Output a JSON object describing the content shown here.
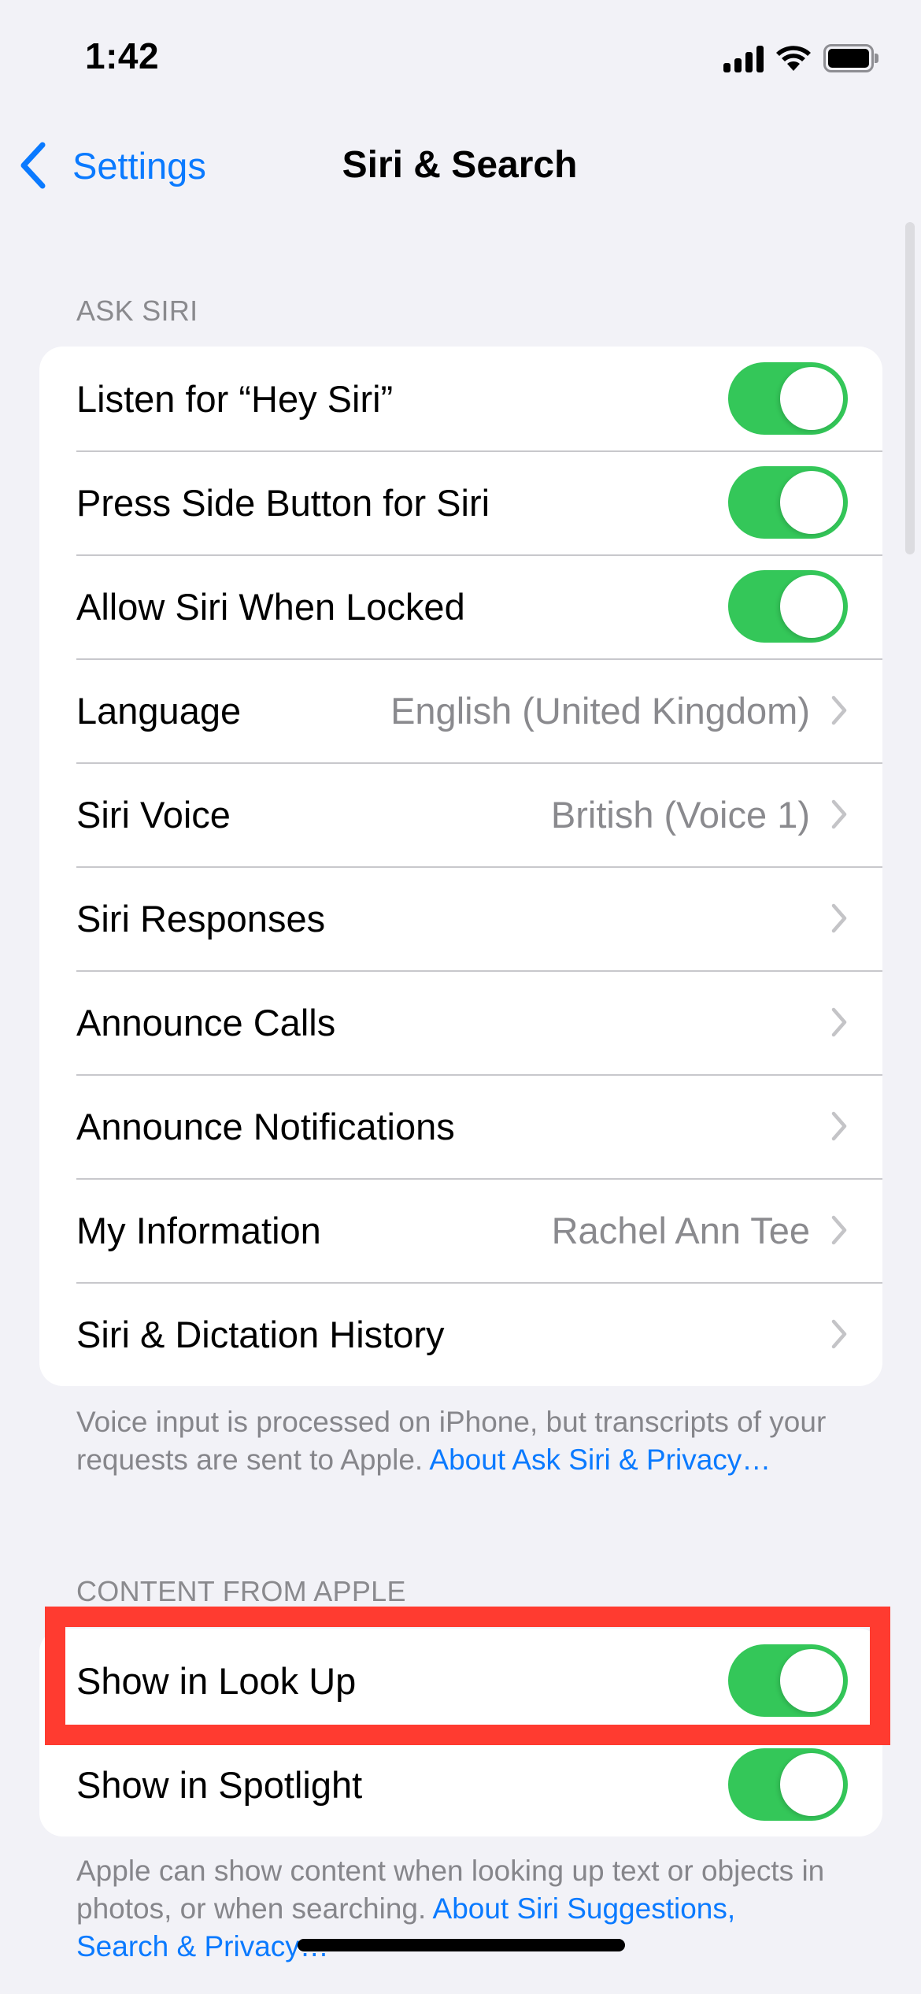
{
  "status_bar": {
    "time": "1:42",
    "icons": [
      "cellular-signal-icon",
      "wifi-icon",
      "battery-icon"
    ],
    "battery_level": 1.0
  },
  "nav": {
    "back_label": "Settings",
    "title": "Siri & Search"
  },
  "colors": {
    "accent": "#0a7aff",
    "toggle_on": "#34c759",
    "background": "#f2f2f7",
    "highlight": "#ff3b30",
    "secondary_text": "#8a8a8e"
  },
  "ask_siri": {
    "header": "ASK SIRI",
    "rows": [
      {
        "label": "Listen for “Hey Siri”",
        "type": "toggle",
        "on": true
      },
      {
        "label": "Press Side Button for Siri",
        "type": "toggle",
        "on": true
      },
      {
        "label": "Allow Siri When Locked",
        "type": "toggle",
        "on": true
      },
      {
        "label": "Language",
        "type": "disclosure",
        "value": "English (United Kingdom)"
      },
      {
        "label": "Siri Voice",
        "type": "disclosure",
        "value": "British (Voice 1)"
      },
      {
        "label": "Siri Responses",
        "type": "disclosure",
        "value": ""
      },
      {
        "label": "Announce Calls",
        "type": "disclosure",
        "value": ""
      },
      {
        "label": "Announce Notifications",
        "type": "disclosure",
        "value": ""
      },
      {
        "label": "My Information",
        "type": "disclosure",
        "value": "Rachel Ann Tee"
      },
      {
        "label": "Siri & Dictation History",
        "type": "disclosure",
        "value": ""
      }
    ],
    "footer_text": "Voice input is processed on iPhone, but transcripts of your requests are sent to Apple. ",
    "footer_link": "About Ask Siri & Privacy…"
  },
  "content_from_apple": {
    "header": "CONTENT FROM APPLE",
    "rows": [
      {
        "label": "Show in Look Up",
        "type": "toggle",
        "on": true,
        "highlighted": true
      },
      {
        "label": "Show in Spotlight",
        "type": "toggle",
        "on": true
      }
    ],
    "footer_text": "Apple can show content when looking up text or objects in photos, or when searching. ",
    "footer_link": "About Siri Suggestions, Search & Privacy…"
  }
}
